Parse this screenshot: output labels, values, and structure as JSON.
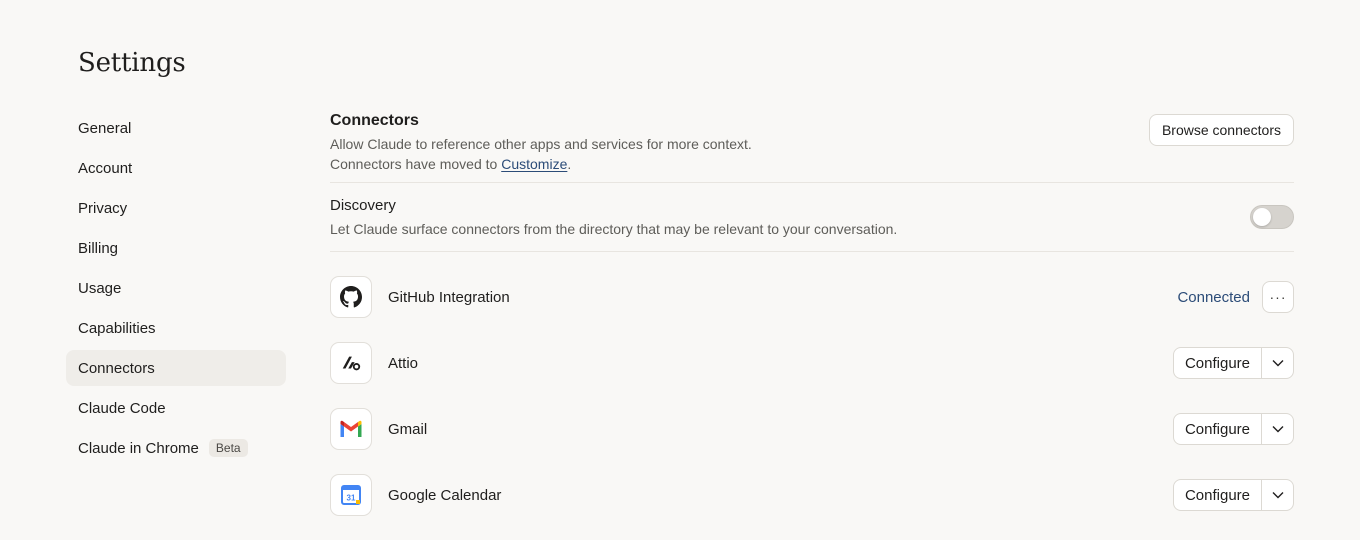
{
  "page": {
    "title": "Settings"
  },
  "sidebar": {
    "items": [
      {
        "label": "General"
      },
      {
        "label": "Account"
      },
      {
        "label": "Privacy"
      },
      {
        "label": "Billing"
      },
      {
        "label": "Usage"
      },
      {
        "label": "Capabilities"
      },
      {
        "label": "Connectors"
      },
      {
        "label": "Claude Code"
      },
      {
        "label": "Claude in Chrome",
        "badge": "Beta"
      }
    ],
    "active": "Connectors"
  },
  "connectors_section": {
    "title": "Connectors",
    "desc_line1": "Allow Claude to reference other apps and services for more context.",
    "desc_line2_prefix": "Connectors have moved to ",
    "desc_line2_link": "Customize",
    "desc_line2_suffix": ".",
    "browse_label": "Browse connectors"
  },
  "discovery": {
    "title": "Discovery",
    "desc": "Let Claude surface connectors from the directory that may be relevant to your conversation.",
    "enabled": false
  },
  "connectors": [
    {
      "name": "GitHub Integration",
      "icon": "github-icon",
      "status": "Connected",
      "more_label": "···"
    },
    {
      "name": "Attio",
      "icon": "attio-icon",
      "action": "Configure"
    },
    {
      "name": "Gmail",
      "icon": "gmail-icon",
      "action": "Configure"
    },
    {
      "name": "Google Calendar",
      "icon": "google-calendar-icon",
      "action": "Configure",
      "calendar_day": "31"
    }
  ],
  "colors": {
    "accent": "#2c4c78",
    "background": "#f9f8f6",
    "active_nav": "#efede9"
  }
}
